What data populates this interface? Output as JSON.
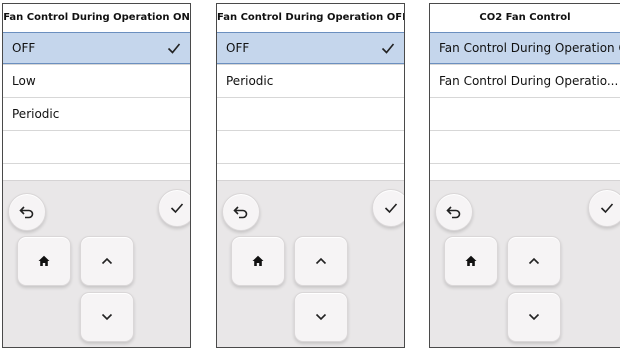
{
  "panels": [
    {
      "title": "Fan Control During Operation ON",
      "options": [
        {
          "label": "OFF",
          "selected": true
        },
        {
          "label": "Low",
          "selected": false
        },
        {
          "label": "Periodic",
          "selected": false
        },
        {
          "label": "",
          "selected": false
        },
        {
          "label": "",
          "selected": false
        }
      ]
    },
    {
      "title": "Fan Control During Operation OFF",
      "options": [
        {
          "label": "OFF",
          "selected": true
        },
        {
          "label": "Periodic",
          "selected": false
        },
        {
          "label": "",
          "selected": false
        },
        {
          "label": "",
          "selected": false
        },
        {
          "label": "",
          "selected": false
        }
      ]
    },
    {
      "title": "CO2 Fan Control",
      "options": [
        {
          "label": "Fan Control During Operation ON",
          "selected": true
        },
        {
          "label": "Fan Control During Operatio...",
          "selected": false
        },
        {
          "label": "",
          "selected": false
        },
        {
          "label": "",
          "selected": false
        },
        {
          "label": "",
          "selected": false
        }
      ]
    }
  ],
  "icons": {
    "back": "back-arrow-icon",
    "confirm": "checkmark-icon",
    "home": "home-icon",
    "up": "chevron-up-icon",
    "down": "chevron-down-icon",
    "selected": "checkmark-icon"
  },
  "colors": {
    "selected_row": "#c5d6ec",
    "pad_background": "#e9e7e8",
    "button_face": "#f6f4f5"
  }
}
